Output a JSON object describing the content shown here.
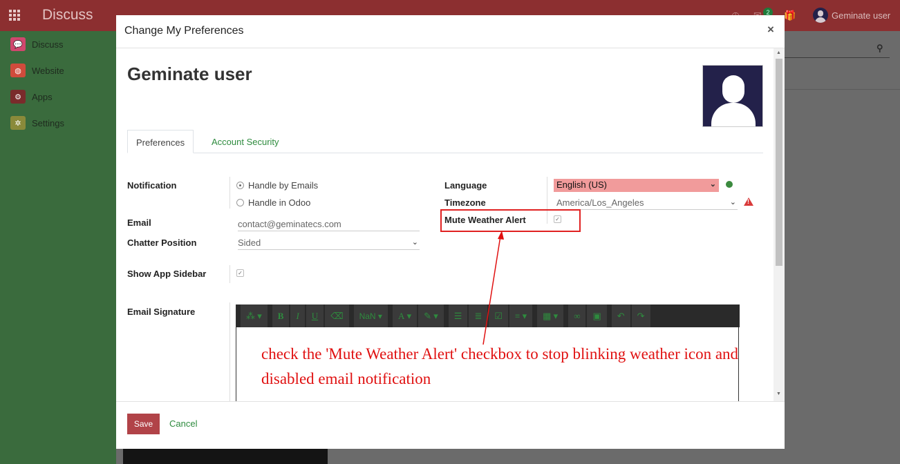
{
  "app": {
    "title": "Discuss",
    "user_name": "Geminate user",
    "badge_count": "2"
  },
  "sidebar": {
    "items": [
      {
        "label": "Discuss",
        "icon": "chat-icon",
        "color": "#d0476e"
      },
      {
        "label": "Website",
        "icon": "globe-icon",
        "color": "#d04b3c"
      },
      {
        "label": "Apps",
        "icon": "apps-icon",
        "color": "#7a2b2b"
      },
      {
        "label": "Settings",
        "icon": "gear-icon",
        "color": "#8a8a3a"
      }
    ]
  },
  "modal": {
    "title": "Change My Preferences",
    "close_label": "×",
    "user_title": "Geminate user",
    "tabs": [
      {
        "label": "Preferences",
        "active": true
      },
      {
        "label": "Account Security",
        "active": false
      }
    ],
    "fields": {
      "notification_label": "Notification",
      "notification_options": [
        "Handle by Emails",
        "Handle in Odoo"
      ],
      "notification_selected": "Handle by Emails",
      "email_label": "Email",
      "email_value": "contact@geminatecs.com",
      "chatter_label": "Chatter Position",
      "chatter_value": "Sided",
      "sidebar_label": "Show App Sidebar",
      "sidebar_checked": true,
      "signature_label": "Email Signature",
      "language_label": "Language",
      "language_value": "English (US)",
      "timezone_label": "Timezone",
      "timezone_value": "America/Los_Angeles",
      "mute_label": "Mute Weather Alert",
      "mute_checked": true
    },
    "editor_toolbar": [
      "magic",
      "B",
      "I",
      "U",
      "eraser",
      "NaN",
      "A",
      "brush",
      "ul",
      "ol",
      "check",
      "align",
      "table",
      "link",
      "image",
      "undo",
      "redo"
    ],
    "annotation": "check the 'Mute Weather Alert' checkbox to stop blinking weather icon and disabled email notification",
    "save_label": "Save",
    "cancel_label": "Cancel",
    "accent_color": "#2e8b3e",
    "primary_color": "#b14348"
  }
}
